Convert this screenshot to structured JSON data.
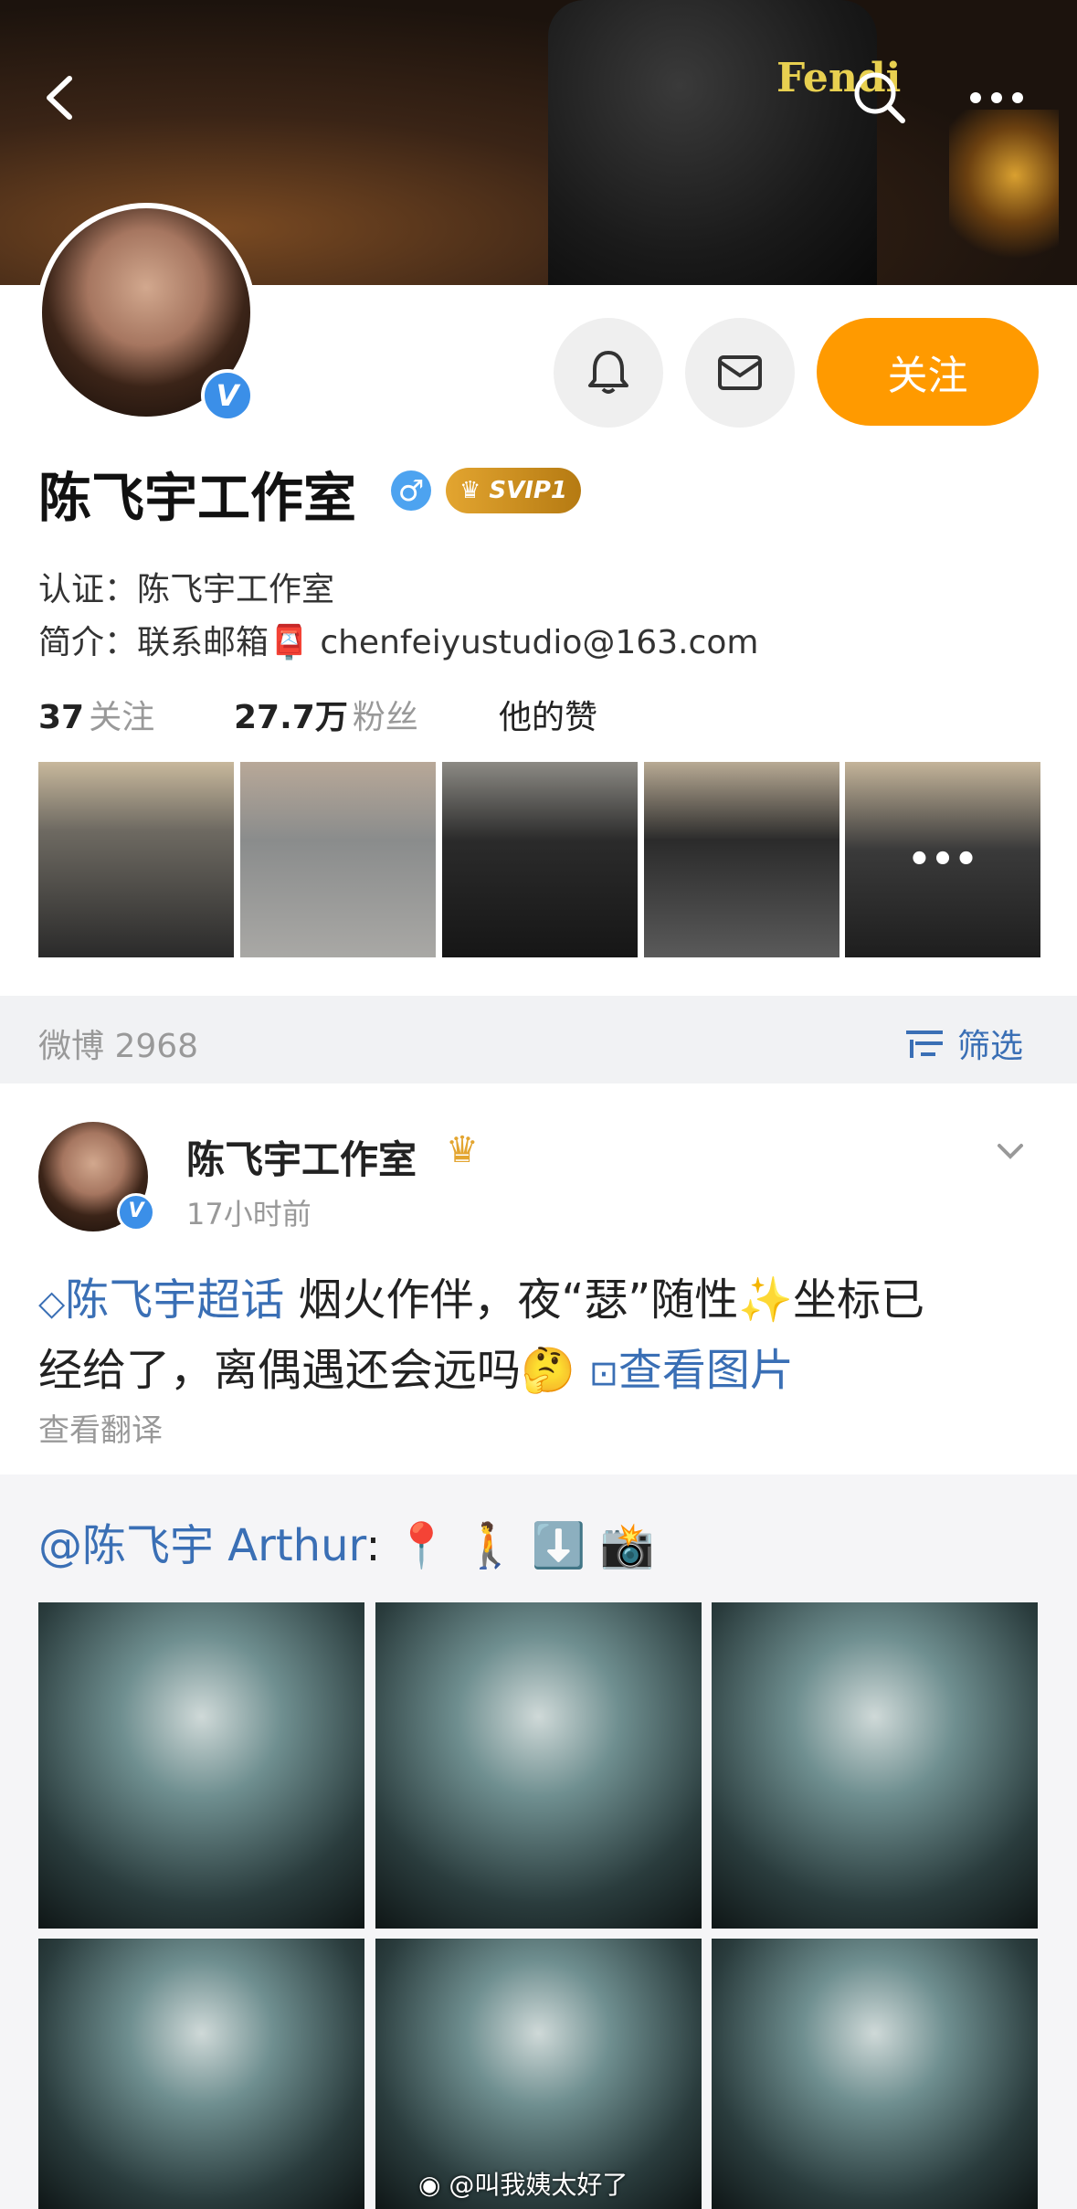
{
  "header": {
    "back_icon": "back-arrow-icon",
    "search_icon": "search-icon",
    "more_icon": "more-dots-icon",
    "banner_logo": "Fendi"
  },
  "profile": {
    "name": "陈飞宇工作室",
    "svip_label": "SVIP1",
    "follow_label": "关注",
    "verify_prefix": "认证：",
    "verify_text": "陈飞宇工作室",
    "intro_prefix": "简介：",
    "intro_text": "联系邮箱",
    "intro_email": "chenfeiyustudio@163.com",
    "following_count": "37",
    "following_label": "关注",
    "followers_count": "27.7万",
    "followers_label": "粉丝",
    "likes_label": "他的赞",
    "more_photos": "•••"
  },
  "weibo_bar": {
    "count_label": "微博 2968",
    "filter_label": "筛选"
  },
  "post": {
    "author": "陈飞宇工作室",
    "time": "17小时前",
    "topic": "陈飞宇超话",
    "text_1": " 烟火作伴，夜“瑟”随性",
    "text_2": "坐标已",
    "text_3": "经给了，离偶遇还会远吗",
    "view_images": "查看图片",
    "translate": "查看翻译"
  },
  "repost": {
    "mention": "@陈飞宇 Arthur",
    "text": ":"
  },
  "watermark": "@叫我姨太好了",
  "colors": {
    "accent_orange": "#ff9a00",
    "link_blue": "#3a6fb5",
    "verified_blue": "#3b8fe8"
  }
}
